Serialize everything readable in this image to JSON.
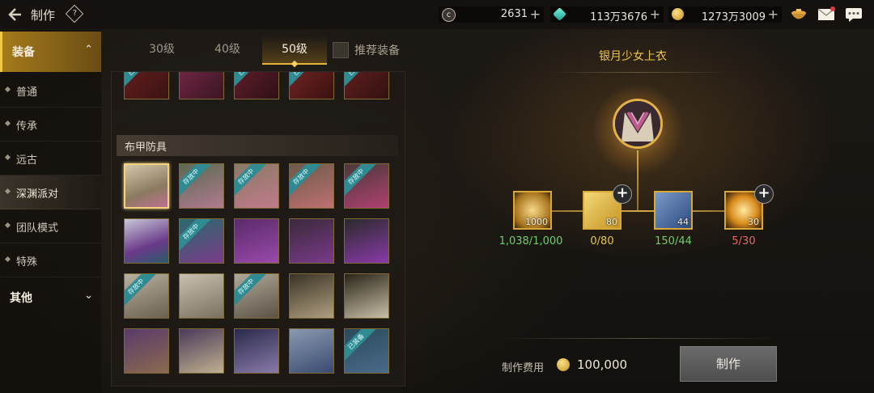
{
  "header": {
    "title": "制作",
    "help_label": "?",
    "currencies": [
      {
        "icon": "c-token-icon",
        "value": "2631",
        "color": "#c9c1b0"
      },
      {
        "icon": "gem-icon",
        "value": "113万3676",
        "color": "#37c1b4"
      },
      {
        "icon": "gold-coin-icon",
        "value": "1273万3009",
        "color": "#e3b340"
      }
    ],
    "plus_label": "+"
  },
  "sidebar": {
    "categories": [
      {
        "label": "装备",
        "chevron": "⌃",
        "expanded": true
      },
      {
        "label": "其他",
        "chevron": "⌄",
        "expanded": false
      }
    ],
    "items": [
      {
        "label": "普通"
      },
      {
        "label": "传承"
      },
      {
        "label": "远古"
      },
      {
        "label": "深渊派对",
        "active": true
      },
      {
        "label": "团队模式"
      },
      {
        "label": "特殊"
      }
    ]
  },
  "tabs": [
    {
      "label": "30级"
    },
    {
      "label": "40级"
    },
    {
      "label": "50级",
      "active": true
    }
  ],
  "recommend_label": "推荐装备",
  "grid": {
    "section_title": "布甲防具",
    "ribbon_label": "存放中",
    "ribbon_label_alt": "已装备"
  },
  "detail": {
    "item_name": "银月少女上衣",
    "materials": [
      {
        "count": "1000",
        "requirement": "1,038/1,000",
        "status": "enough",
        "has_plus": false
      },
      {
        "count": "80",
        "requirement": "0/80",
        "status": "insufficient",
        "has_plus": true
      },
      {
        "count": "44",
        "requirement": "150/44",
        "status": "enough",
        "has_plus": false
      },
      {
        "count": "30",
        "requirement": "5/30",
        "status": "insufficient",
        "has_plus": true
      }
    ],
    "plus_label": "+",
    "cost_label": "制作费用",
    "cost_value": "100,000",
    "craft_button": "制作"
  }
}
